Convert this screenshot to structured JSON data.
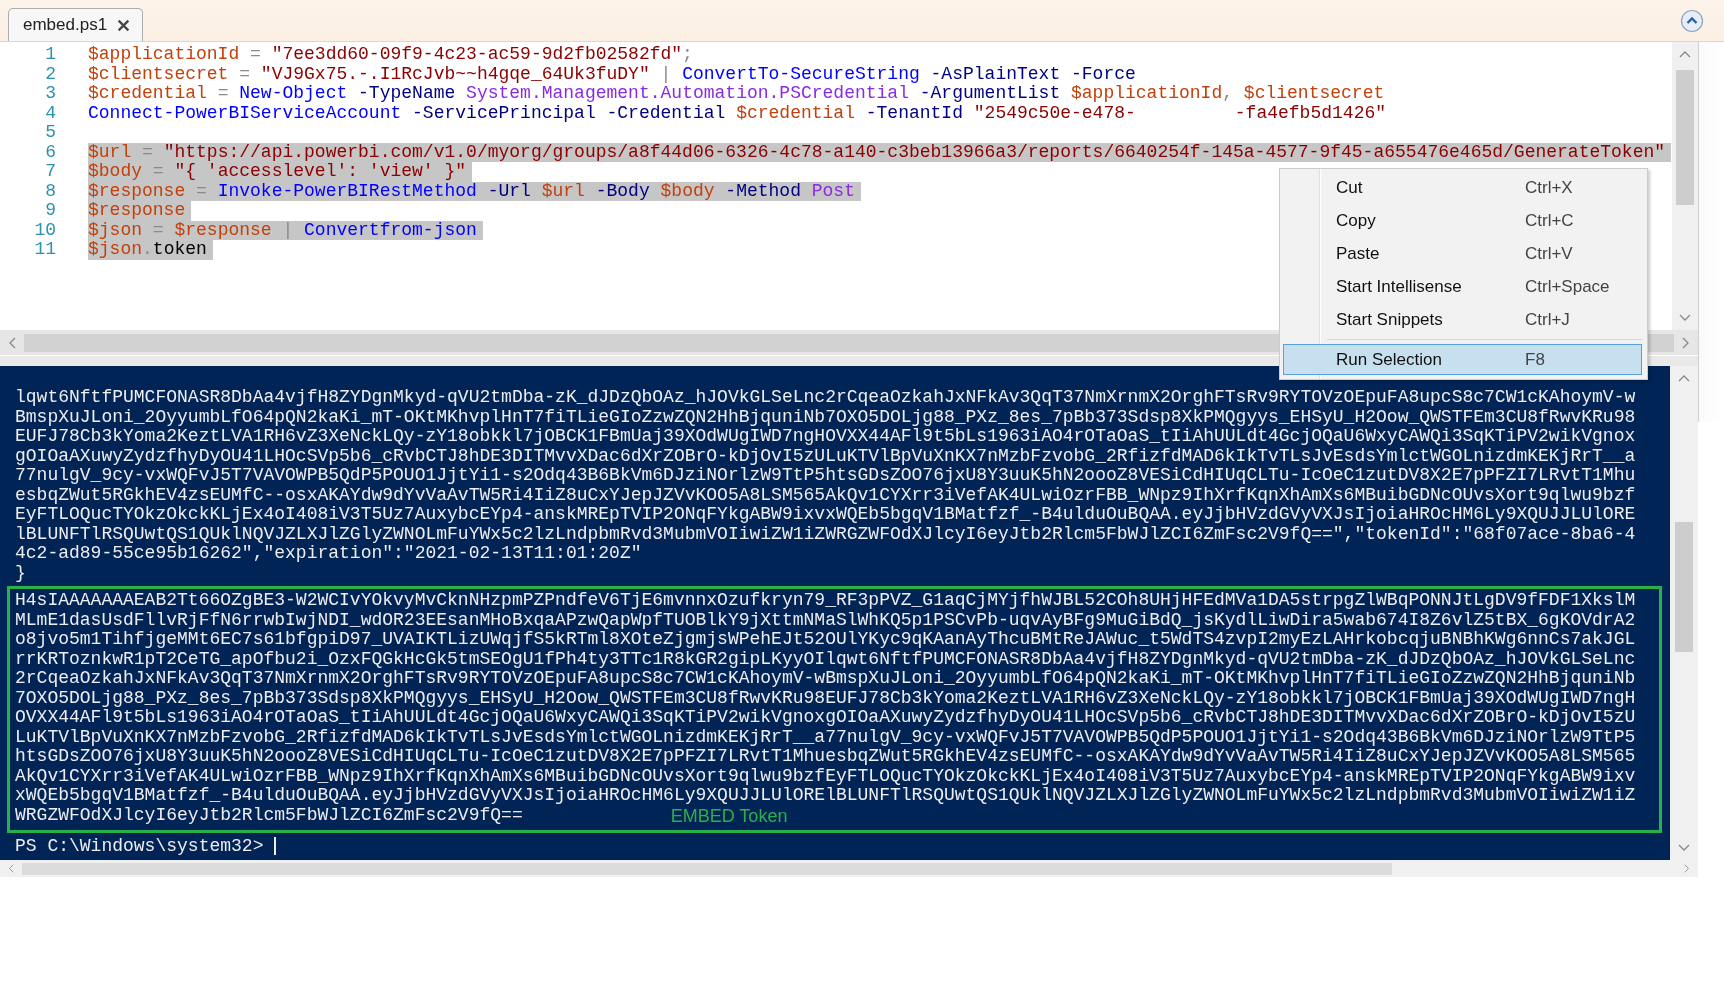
{
  "tab": {
    "title": "embed.ps1"
  },
  "editor": {
    "lines": [
      {
        "number": "1",
        "selected": false,
        "tokens": [
          {
            "kind": "variable",
            "text": "$applicationId"
          },
          {
            "kind": "operator",
            "text": " = "
          },
          {
            "kind": "string",
            "text": "\"7ee3dd60-09f9-4c23-ac59-9d2fb02582fd\""
          },
          {
            "kind": "operator",
            "text": ";"
          }
        ]
      },
      {
        "number": "2",
        "selected": false,
        "tokens": [
          {
            "kind": "variable",
            "text": "$clientsecret"
          },
          {
            "kind": "operator",
            "text": " = "
          },
          {
            "kind": "string",
            "text": "\"VJ9Gx75.-.I1RcJvb~~h4gqe_64Uk3fuDY\""
          },
          {
            "kind": "operator",
            "text": " | "
          },
          {
            "kind": "command",
            "text": "ConvertTo-SecureString"
          },
          {
            "kind": "parameter",
            "text": " -AsPlainText -Force"
          }
        ]
      },
      {
        "number": "3",
        "selected": false,
        "tokens": [
          {
            "kind": "variable",
            "text": "$credential"
          },
          {
            "kind": "operator",
            "text": " = "
          },
          {
            "kind": "command",
            "text": "New-Object"
          },
          {
            "kind": "parameter",
            "text": " -TypeName "
          },
          {
            "kind": "type",
            "text": "System.Management.Automation.PSCredential"
          },
          {
            "kind": "parameter",
            "text": " -ArgumentList "
          },
          {
            "kind": "variable",
            "text": "$applicationId"
          },
          {
            "kind": "operator",
            "text": ", "
          },
          {
            "kind": "variable",
            "text": "$clientsecret"
          }
        ]
      },
      {
        "number": "4",
        "selected": false,
        "tokens": [
          {
            "kind": "command",
            "text": "Connect-PowerBIServiceAccount"
          },
          {
            "kind": "parameter",
            "text": " -ServicePrincipal -Credential "
          },
          {
            "kind": "variable",
            "text": "$credential"
          },
          {
            "kind": "parameter",
            "text": " -TenantId "
          },
          {
            "kind": "string",
            "text": "\"2549c50e-e478-"
          },
          {
            "kind": "string_after_redaction",
            "text": "-fa4efb5d1426\""
          }
        ]
      },
      {
        "number": "5",
        "selected": false
      },
      {
        "number": "6",
        "selected": true,
        "tokens": [
          {
            "kind": "variable",
            "text": "$url"
          },
          {
            "kind": "operator",
            "text": " = "
          },
          {
            "kind": "string",
            "text": "\"https://api.powerbi.com/v1.0/myorg/groups/a8f44d06-6326-4c78-a140-c3beb13966a3/reports/6640254f-145a-4577-9f45-a655476e465d/GenerateToken\""
          }
        ]
      },
      {
        "number": "7",
        "selected": true,
        "tokens": [
          {
            "kind": "variable",
            "text": "$body"
          },
          {
            "kind": "operator",
            "text": " = "
          },
          {
            "kind": "string",
            "text": "\"{ 'accesslevel': 'view' }\""
          }
        ]
      },
      {
        "number": "8",
        "selected": true,
        "tokens": [
          {
            "kind": "variable",
            "text": "$response"
          },
          {
            "kind": "operator",
            "text": " = "
          },
          {
            "kind": "command",
            "text": "Invoke-PowerBIRestMethod"
          },
          {
            "kind": "parameter",
            "text": " -Url "
          },
          {
            "kind": "variable",
            "text": "$url"
          },
          {
            "kind": "parameter",
            "text": " -Body "
          },
          {
            "kind": "variable",
            "text": "$body"
          },
          {
            "kind": "parameter",
            "text": " -Method "
          },
          {
            "kind": "type",
            "text": "Post"
          }
        ]
      },
      {
        "number": "9",
        "selected": true,
        "tokens": [
          {
            "kind": "variable",
            "text": "$response"
          }
        ]
      },
      {
        "number": "10",
        "selected": true,
        "tokens": [
          {
            "kind": "variable",
            "text": "$json"
          },
          {
            "kind": "operator",
            "text": " = "
          },
          {
            "kind": "variable",
            "text": "$response"
          },
          {
            "kind": "operator",
            "text": " | "
          },
          {
            "kind": "command",
            "text": "Convertfrom-json"
          }
        ]
      },
      {
        "number": "11",
        "selected": true,
        "tokens": [
          {
            "kind": "variable",
            "text": "$json"
          },
          {
            "kind": "operator",
            "text": "."
          },
          {
            "kind": "member",
            "text": "token"
          }
        ]
      }
    ]
  },
  "context_menu": {
    "items": [
      {
        "label": "Cut",
        "shortcut": "Ctrl+X",
        "selected": false,
        "separator_before": false
      },
      {
        "label": "Copy",
        "shortcut": "Ctrl+C",
        "selected": false,
        "separator_before": false
      },
      {
        "label": "Paste",
        "shortcut": "Ctrl+V",
        "selected": false,
        "separator_before": false
      },
      {
        "label": "Start Intellisense",
        "shortcut": "Ctrl+Space",
        "selected": false,
        "separator_before": false
      },
      {
        "label": "Start Snippets",
        "shortcut": "Ctrl+J",
        "selected": false,
        "separator_before": false
      },
      {
        "label": "Run Selection",
        "shortcut": "F8",
        "selected": true,
        "separator_before": true
      }
    ]
  },
  "console": {
    "output_lines": [
      "lqwt6NftfPUMCFONASR8DbAa4vjfH8ZYDgnMkyd-qVU2tmDba-zK_dJDzQbOAz_hJOVkGLSeLnc2rCqeaOzkahJxNFkAv3QqT37NmXrnmX2OrghFTsRv9RYTOVzOEpuFA8upcS8c7CW1cKAhoymV-w",
      "BmspXuJLoni_2OyyumbLfO64pQN2kaKi_mT-OKtMKhvplHnT7fiTLieGIoZzwZQN2HhBjquniNb7OXO5DOLjg88_PXz_8es_7pBb373Sdsp8XkPMQgyys_EHSyU_H2Oow_QWSTFEm3CU8fRwvKRu98",
      "EUFJ78Cb3kYoma2KeztLVA1RH6vZ3XeNckLQy-zY18obkkl7jOBCK1FBmUaj39XOdWUgIWD7ngHOVXX44AFl9t5bLs1963iAO4rOTaOaS_tIiAhUULdt4GcjOQaU6WxyCAWQi3SqKTiPV2wikVgnox",
      "gOIOaAXuwyZydzfhyDyOU41LHOcSVp5b6_cRvbCTJ8hDE3DITMvvXDac6dXrZOBrO-kDjOvI5zULuKTVlBpVuXnKX7nMzbFzvobG_2RfizfdMAD6kIkTvTLsJvEsdsYmlctWGOLnizdmKEKjRrT__a",
      "77nulgV_9cy-vxWQFvJ5T7VAVOWPB5QdP5POUO1JjtYi1-s2Odq43B6BkVm6DJziNOrlzW9TtP5htsGDsZOO76jxU8Y3uuK5hN2oooZ8VESiCdHIUqCLTu-IcOeC1zutDV8X2E7pPFZI7LRvtT1Mhu",
      "esbqZWut5RGkhEV4zsEUMfC--osxAKAYdw9dYvVaAvTW5Ri4IiZ8uCxYJepJZVvKOO5A8LSM565AkQv1CYXrr3iVefAK4ULwiOzrFBB_WNpz9IhXrfKqnXhAmXs6MBuibGDNcOUvsXort9qlwu9bzf",
      "EyFTLOQucTYOkzOkckKLjEx4oI408iV3T5Uz7AuxybcEYp4-anskMREpTVIP2ONqFYkgABW9ixvxWQEb5bgqV1BMatfzf_-B4ulduOuBQAA.eyJjbHVzdGVyVXJsIjoiaHROcHM6Ly9XQUJJLUlORE",
      "lBLUNFTlRSQUwtQS1QUklNQVJZLXJlZGlyZWNOLmFuYWx5c2lzLndpbmRvd3MubmVOIiwiZW1iZWRGZWFOdXJlcyI6eyJtb2Rlcm5FbWJlZCI6ZmFsc2V9fQ==\",\"tokenId\":\"68f07ace-8ba6-4",
      "4c2-ad89-55ce95b16262\",\"expiration\":\"2021-02-13T11:01:20Z\"",
      "}"
    ],
    "token_block": {
      "label": "EMBED Token",
      "lines": [
        "H4sIAAAAAAAEAB2Tt66OZgBE3-W2WCIvYOkvyMvCknNHzpmPZPndfeV6TjE6mvnnxOzufkryn79_RF3pPVZ_G1aqCjMYjfhWJBL52COh8UHjHFEdMVa1DA5strpgZlWBqPONNJtLgDV9fFDF1XkslM",
        "MLmE1dasUsdFllvRjFfN6rrwbIwjNDI_wdOR23EEsanMHoBxqaAPzwQapWpfTUOBlkY9jXttmNMaSlWhKQ5p1PSCvPb-uqvAyBFg9MuGiBdQ_jsKydlLiwDira5wab674I8Z6vlZ5tBX_6gKOVdrA2",
        "o8jvo5m1TihfjgeMMt6EC7s61bfgpiD97_UVAIKTLizUWqjfS5kRTml8XOteZjgmjsWPehEJt52OUlYKyc9qKAanAyThcuBMtReJAWuc_t5WdTS4zvpI2myEzLAHrkobcqjuBNBhKWg6nnCs7akJGL",
        "rrKRToznkwR1pT2CeTG_apOfbu2i_OzxFQGkHcGk5tmSEOgU1fPh4ty3TTc1R8kGR2gipLKyyOIlqwt6NftfPUMCFONASR8DbAa4vjfH8ZYDgnMkyd-qVU2tmDba-zK_dJDzQbOAz_hJOVkGLSeLnc",
        "2rCqeaOzkahJxNFkAv3QqT37NmXrnmX2OrghFTsRv9RYTOVzOEpuFA8upcS8c7CW1cKAhoymV-wBmspXuJLoni_2OyyumbLfO64pQN2kaKi_mT-OKtMKhvplHnT7fiTLieGIoZzwZQN2HhBjquniNb",
        "7OXO5DOLjg88_PXz_8es_7pBb373Sdsp8XkPMQgyys_EHSyU_H2Oow_QWSTFEm3CU8fRwvKRu98EUFJ78Cb3kYoma2KeztLVA1RH6vZ3XeNckLQy-zY18obkkl7jOBCK1FBmUaj39XOdWUgIWD7ngH",
        "OVXX44AFl9t5bLs1963iAO4rOTaOaS_tIiAhUULdt4GcjOQaU6WxyCAWQi3SqKTiPV2wikVgnoxgOIOaAXuwyZydzfhyDyOU41LHOcSVp5b6_cRvbCTJ8hDE3DITMvvXDac6dXrZOBrO-kDjOvI5zU",
        "LuKTVlBpVuXnKX7nMzbFzvobG_2RfizfdMAD6kIkTvTLsJvEsdsYmlctWGOLnizdmKEKjRrT__a77nulgV_9cy-vxWQFvJ5T7VAVOWPB5QdP5POUO1JjtYi1-s2Odq43B6BkVm6DJziNOrlzW9TtP5",
        "htsGDsZOO76jxU8Y3uuK5hN2oooZ8VESiCdHIUqCLTu-IcOeC1zutDV8X2E7pPFZI7LRvtT1MhuesbqZWut5RGkhEV4zsEUMfC--osxAKAYdw9dYvVaAvTW5Ri4IiZ8uCxYJepJZVvKOO5A8LSM565",
        "AkQv1CYXrr3iVefAK4ULwiOzrFBB_WNpz9IhXrfKqnXhAmXs6MBuibGDNcOUvsXort9qlwu9bzfEyFTLOQucTYOkzOkckKLjEx4oI408iV3T5Uz7AuxybcEYp4-anskMREpTVIP2ONqFYkgABW9ixv",
        "xWQEb5bgqV1BMatfzf_-B4ulduOuBQAA.eyJjbHVzdGVyVXJsIjoiaHROcHM6Ly9XQUJJLUlORElBLUNFTlRSQUwtQS1QUklNQVJZLXJlZGlyZWNOLmFuYWx5c2lzLndpbmRvd3MubmVOIiwiZW1iZ",
        "WRGZWFOdXJlcyI6eyJtb2Rlcm5FbWJlZCI6ZmFsc2V9fQ=="
      ]
    },
    "prompt": "PS C:\\Windows\\system32>"
  }
}
